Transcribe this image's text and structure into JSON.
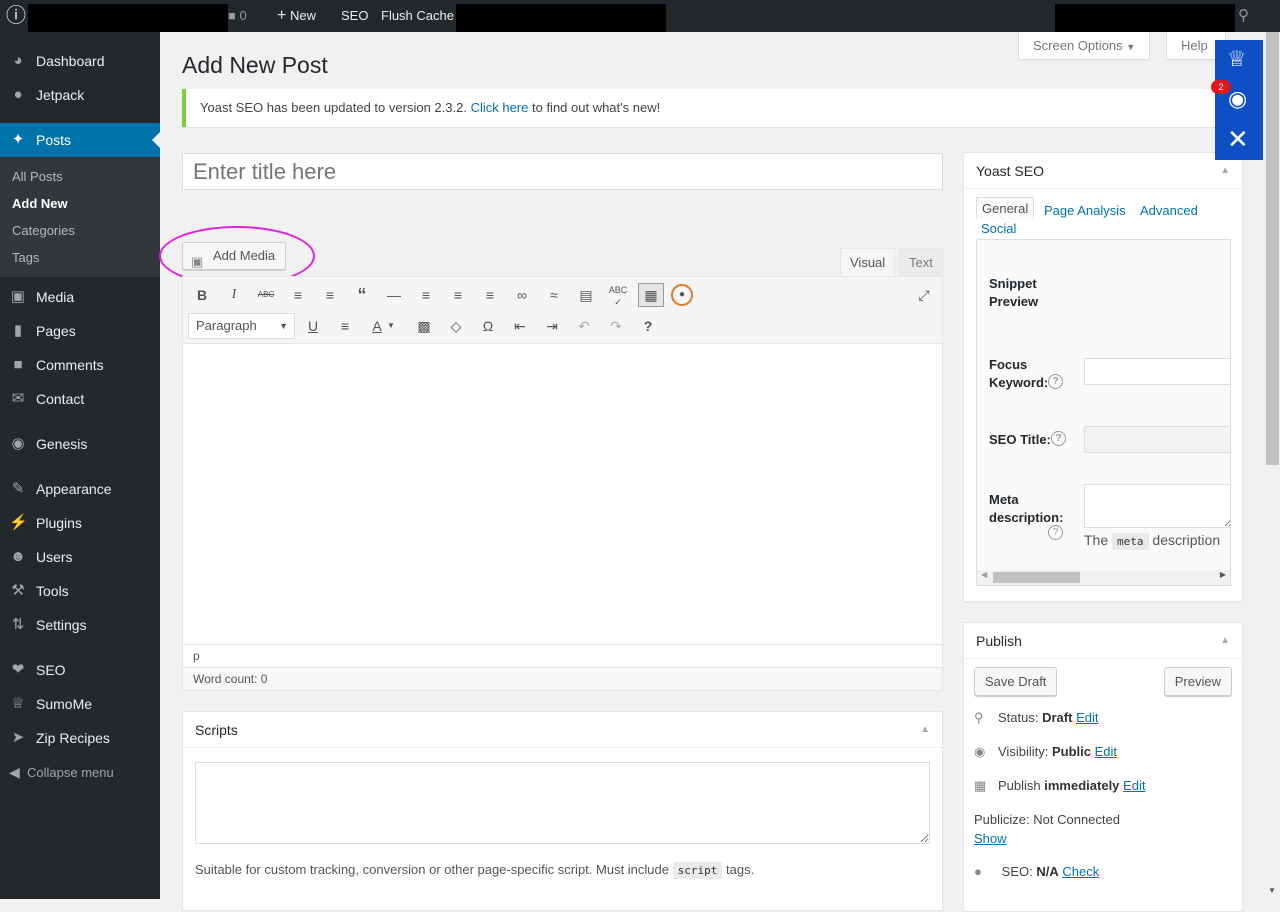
{
  "adminbar": {
    "comments_count": "0",
    "new_label": "New",
    "seo_label": "SEO",
    "flush_cache_label": "Flush Cache"
  },
  "sidebar": {
    "items": [
      {
        "label": "Dashboard",
        "icon": "dashboard-icon"
      },
      {
        "label": "Jetpack",
        "icon": "jetpack-icon"
      },
      {
        "label": "Posts",
        "icon": "pin-icon",
        "active": true
      },
      {
        "label": "Media",
        "icon": "media-icon"
      },
      {
        "label": "Pages",
        "icon": "pages-icon"
      },
      {
        "label": "Comments",
        "icon": "comment-icon"
      },
      {
        "label": "Contact",
        "icon": "envelope-icon"
      },
      {
        "label": "Genesis",
        "icon": "genesis-icon"
      },
      {
        "label": "Appearance",
        "icon": "paintbrush-icon"
      },
      {
        "label": "Plugins",
        "icon": "plug-icon"
      },
      {
        "label": "Users",
        "icon": "user-icon"
      },
      {
        "label": "Tools",
        "icon": "wrench-icon"
      },
      {
        "label": "Settings",
        "icon": "sliders-icon"
      },
      {
        "label": "SEO",
        "icon": "yoast-icon"
      },
      {
        "label": "SumoMe",
        "icon": "crown-icon"
      },
      {
        "label": "Zip Recipes",
        "icon": "carrot-icon"
      }
    ],
    "submenu": [
      "All Posts",
      "Add New",
      "Categories",
      "Tags"
    ],
    "collapse_label": "Collapse menu"
  },
  "header": {
    "screen_options": "Screen Options",
    "help": "Help",
    "title": "Add New Post"
  },
  "notice": {
    "text_before": "Yoast SEO has been updated to version 2.3.2.",
    "link": "Click here",
    "text_after": "to find out what's new!"
  },
  "editor": {
    "title_placeholder": "Enter title here",
    "add_media": "Add Media",
    "tab_visual": "Visual",
    "tab_text": "Text",
    "format_select": "Paragraph",
    "path": "p",
    "word_count": "Word count: 0"
  },
  "scripts_box": {
    "title": "Scripts",
    "desc_before": "Suitable for custom tracking, conversion or other page-specific script. Must include",
    "code": "script",
    "desc_after": "tags."
  },
  "yoast": {
    "title": "Yoast SEO",
    "tabs": [
      "General",
      "Page Analysis",
      "Advanced",
      "Social"
    ],
    "snippet_label": "Snippet Preview",
    "focus_keyword_label": "Focus Keyword:",
    "seo_title_label": "SEO Title:",
    "meta_desc_label": "Meta description:",
    "meta_note_before": "The",
    "meta_note_code": "meta",
    "meta_note_after": "description"
  },
  "publish": {
    "title": "Publish",
    "save_draft": "Save Draft",
    "preview": "Preview",
    "status_label": "Status:",
    "status_value": "Draft",
    "visibility_label": "Visibility:",
    "visibility_value": "Public",
    "publish_label": "Publish",
    "publish_value": "immediately",
    "edit": "Edit",
    "publicize": "Publicize: Not Connected",
    "show": "Show",
    "seo_label": "SEO:",
    "seo_value": "N/A",
    "check": "Check"
  },
  "sumome": {
    "badge_count": "2",
    "accent": "#0d4fc4"
  },
  "colors": {
    "admin_bg": "#23282d",
    "active_menu": "#0073aa",
    "link": "#0073aa",
    "notice_border": "#7ad03a",
    "highlight_ring": "#e020e0"
  }
}
